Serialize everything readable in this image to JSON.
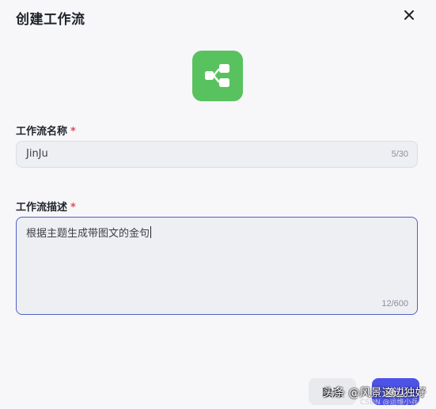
{
  "dialog": {
    "title": "创建工作流",
    "close_icon": "close-icon",
    "app_icon": "workflow-icon",
    "app_icon_color": "#58c25e"
  },
  "form": {
    "name_label": "工作流名称",
    "name_required": "*",
    "name_value": "JinJu",
    "name_counter": "5/30",
    "desc_label": "工作流描述",
    "desc_required": "*",
    "desc_value": "根据主题生成带图文的金句",
    "desc_counter": "12/600"
  },
  "footer": {
    "cancel_label": "取消",
    "create_label": "确认"
  },
  "watermark": {
    "main": "头条 @风景这边独好",
    "sub": "CSDN @运维小兵"
  },
  "colors": {
    "accent": "#4d53e8",
    "required": "#e34d59",
    "focus_border": "#5060c8"
  }
}
